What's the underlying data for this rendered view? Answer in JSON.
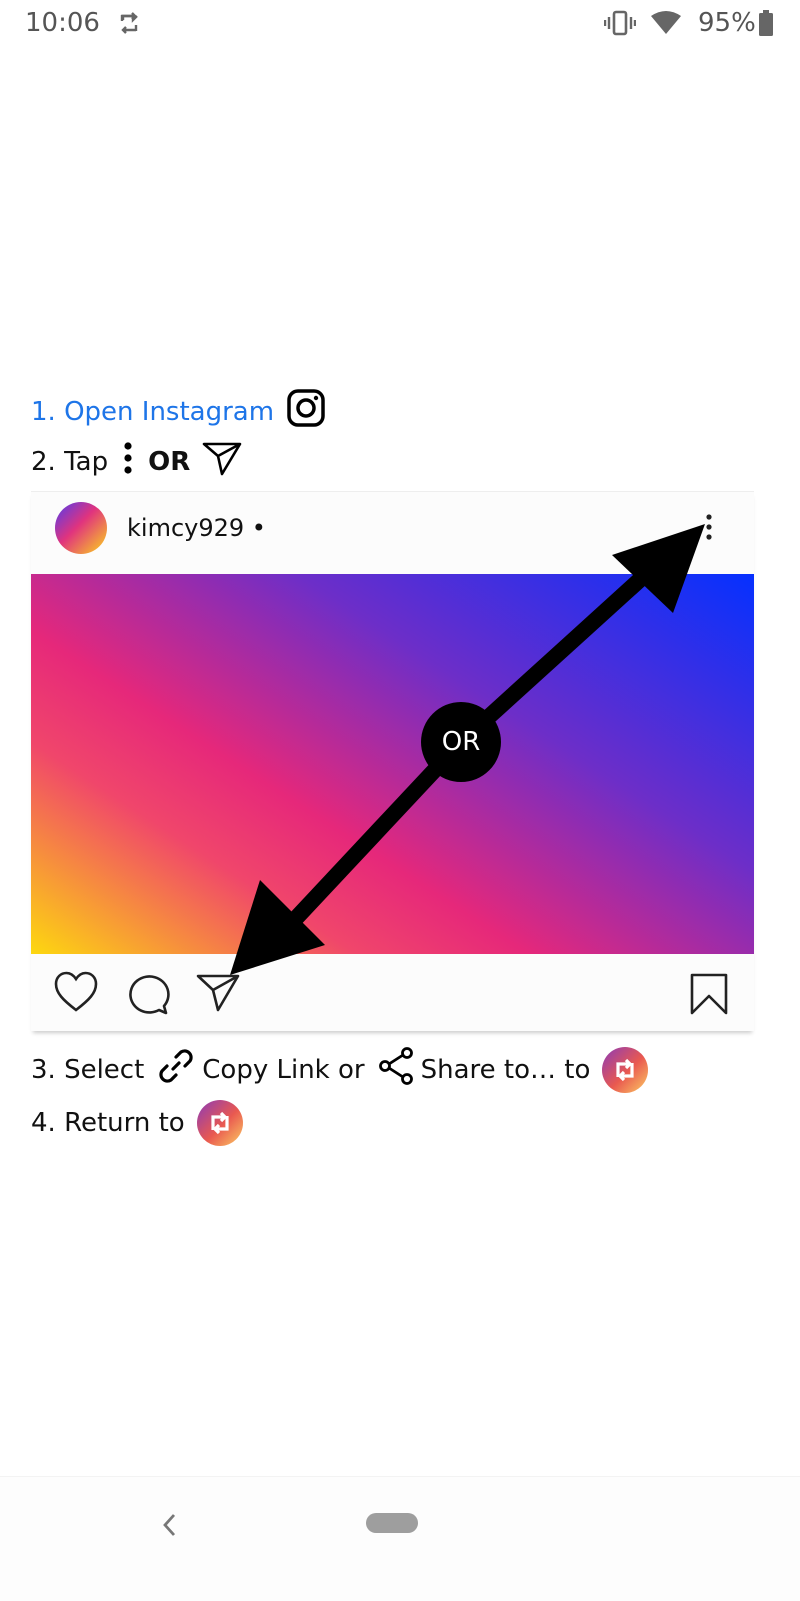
{
  "status_bar": {
    "time": "10:06",
    "battery": "95%"
  },
  "steps": {
    "step1": "1. Open Instagram",
    "step2_prefix": "2. Tap",
    "step2_or": "OR",
    "step3_prefix": "3. Select",
    "step3_copy": "Copy Link or",
    "step3_share": "Share to… to",
    "step4_prefix": "4. Return to"
  },
  "post": {
    "username": "kimcy929 •",
    "or_label": "OR"
  },
  "icons": {
    "status": [
      "repost-icon",
      "vibrate-icon",
      "wifi-icon",
      "battery-icon"
    ],
    "post_actions": [
      "heart-icon",
      "comment-icon",
      "send-icon",
      "bookmark-icon"
    ],
    "nav": [
      "back-icon",
      "home-pill"
    ]
  }
}
